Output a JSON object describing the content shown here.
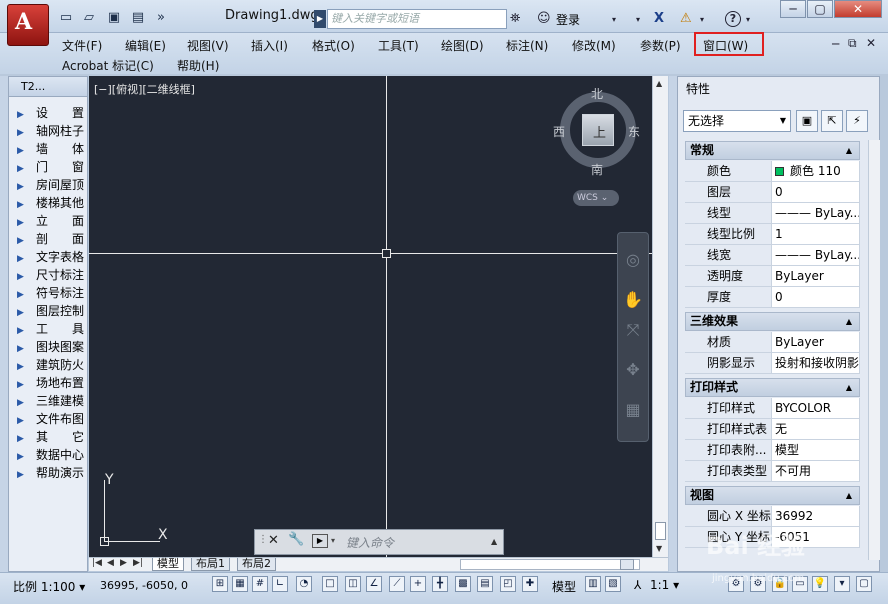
{
  "title_bar": {
    "document_title": "Drawing1.dwg",
    "search_placeholder": "键入关键字或短语",
    "login_label": "登录",
    "help_glyph": "?"
  },
  "menus": {
    "row1": [
      "文件(F)",
      "编辑(E)",
      "视图(V)",
      "插入(I)",
      "格式(O)",
      "工具(T)",
      "绘图(D)",
      "标注(N)",
      "修改(M)",
      "参数(P)",
      "窗口(W)"
    ],
    "row2": [
      "Acrobat 标记(C)",
      "帮助(H)"
    ],
    "highlighted": "窗口(W)"
  },
  "left_palette": {
    "title": "T2...",
    "items": [
      "设　　置",
      "轴网柱子",
      "墙　　体",
      "门　　窗",
      "房间屋顶",
      "楼梯其他",
      "立　　面",
      "剖　　面",
      "文字表格",
      "尺寸标注",
      "符号标注",
      "图层控制",
      "工　　具",
      "图块图案",
      "建筑防火",
      "场地布置",
      "三维建模",
      "文件布图",
      "其　　它",
      "数据中心",
      "帮助演示"
    ]
  },
  "viewport": {
    "label": "[−][俯视][二维线框]",
    "viewcube": {
      "north": "北",
      "south": "南",
      "east": "东",
      "west": "西",
      "top_face": "上"
    },
    "wcs": "WCS ⌄",
    "ucs_x": "X",
    "ucs_y": "Y"
  },
  "command_line": {
    "placeholder": "键入命令"
  },
  "layout_tabs": [
    "模型",
    "布局1",
    "布局2"
  ],
  "properties": {
    "title": "特性",
    "selection": "无选择",
    "sections": [
      {
        "name": "常规",
        "rows": [
          {
            "key": "颜色",
            "value": "ByLayer",
            "display": "颜色 110",
            "swatch": "#00c060"
          },
          {
            "key": "图层",
            "value": "0"
          },
          {
            "key": "线型",
            "value": "——— ByLay..."
          },
          {
            "key": "线型比例",
            "value": "1"
          },
          {
            "key": "线宽",
            "value": "——— ByLay..."
          },
          {
            "key": "透明度",
            "value": "ByLayer"
          },
          {
            "key": "厚度",
            "value": "0"
          }
        ]
      },
      {
        "name": "三维效果",
        "rows": [
          {
            "key": "材质",
            "value": "ByLayer"
          },
          {
            "key": "阴影显示",
            "value": "投射和接收阴影"
          }
        ]
      },
      {
        "name": "打印样式",
        "rows": [
          {
            "key": "打印样式",
            "value": "BYCOLOR"
          },
          {
            "key": "打印样式表",
            "value": "无"
          },
          {
            "key": "打印表附...",
            "value": "模型"
          },
          {
            "key": "打印表类型",
            "value": "不可用"
          }
        ]
      },
      {
        "name": "视图",
        "rows": [
          {
            "key": "圆心 X 坐标",
            "value": "36992"
          },
          {
            "key": "圆心 Y 坐标",
            "value": "-6051"
          }
        ]
      }
    ]
  },
  "status_bar": {
    "scale": "比例 1:100 ▾",
    "coordinates": "36995, -6050, 0",
    "model": "模型",
    "annotation_scale": "1:1 ▾"
  },
  "watermark": {
    "text": "Bai 经验",
    "url": "jingyan.baidu.com"
  }
}
